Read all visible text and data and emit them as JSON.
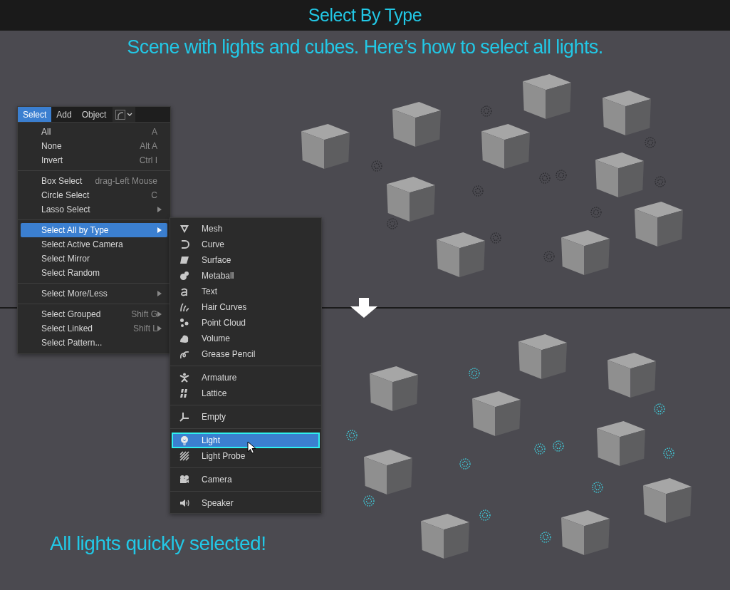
{
  "title": "Select By Type",
  "subtitle": "Scene with lights and cubes. Here’s how to select all lights.",
  "caption": "All lights quickly selected!",
  "viewports": [
    {
      "lights_selected": false
    },
    {
      "lights_selected": true
    }
  ],
  "menu_bar": [
    {
      "label": "Select",
      "selected": true
    },
    {
      "label": "Add",
      "selected": false
    },
    {
      "label": "Object",
      "selected": false
    }
  ],
  "select_menu": [
    [
      {
        "label": "All",
        "shortcut": "A",
        "submenu": false,
        "selected": false
      },
      {
        "label": "None",
        "shortcut": "Alt A",
        "submenu": false,
        "selected": false
      },
      {
        "label": "Invert",
        "shortcut": "Ctrl I",
        "submenu": false,
        "selected": false
      }
    ],
    [
      {
        "label": "Box Select",
        "shortcut": "drag-Left Mouse",
        "submenu": false,
        "selected": false
      },
      {
        "label": "Circle Select",
        "shortcut": "C",
        "submenu": false,
        "selected": false
      },
      {
        "label": "Lasso Select",
        "submenu": true,
        "selected": false
      }
    ],
    [
      {
        "label": "Select All by Type",
        "submenu": true,
        "selected": true
      },
      {
        "label": "Select Active Camera",
        "submenu": false,
        "selected": false
      },
      {
        "label": "Select Mirror",
        "submenu": false,
        "selected": false
      },
      {
        "label": "Select Random",
        "submenu": false,
        "selected": false
      }
    ],
    [
      {
        "label": "Select More/Less",
        "submenu": true,
        "selected": false
      }
    ],
    [
      {
        "label": "Select Grouped",
        "shortcut": "Shift G",
        "submenu": true,
        "selected": false
      },
      {
        "label": "Select Linked",
        "shortcut": "Shift L",
        "submenu": true,
        "selected": false
      },
      {
        "label": "Select Pattern...",
        "submenu": false,
        "selected": false
      }
    ]
  ],
  "type_menu": [
    [
      {
        "label": "Mesh",
        "selected": false
      },
      {
        "label": "Curve",
        "selected": false
      },
      {
        "label": "Surface",
        "selected": false
      },
      {
        "label": "Metaball",
        "selected": false
      },
      {
        "label": "Text",
        "selected": false
      },
      {
        "label": "Hair Curves",
        "selected": false
      },
      {
        "label": "Point Cloud",
        "selected": false
      },
      {
        "label": "Volume",
        "selected": false
      },
      {
        "label": "Grease Pencil",
        "selected": false
      }
    ],
    [
      {
        "label": "Armature",
        "selected": false
      },
      {
        "label": "Lattice",
        "selected": false
      }
    ],
    [
      {
        "label": "Empty",
        "selected": false
      }
    ],
    [
      {
        "label": "Light",
        "selected": true
      },
      {
        "label": "Light Probe",
        "selected": false
      }
    ],
    [
      {
        "label": "Camera",
        "selected": false
      }
    ],
    [
      {
        "label": "Speaker",
        "selected": false
      }
    ]
  ]
}
